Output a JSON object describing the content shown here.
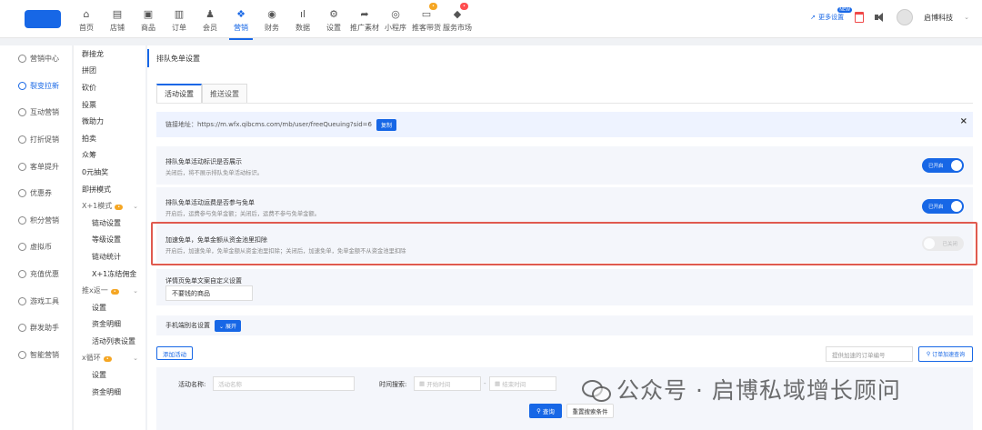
{
  "topnav": {
    "items": [
      {
        "label": "首页",
        "icon": "home-icon",
        "glyph": "⌂"
      },
      {
        "label": "店铺",
        "icon": "store-icon",
        "glyph": "▤"
      },
      {
        "label": "商品",
        "icon": "product-icon",
        "glyph": "▣"
      },
      {
        "label": "订单",
        "icon": "order-icon",
        "glyph": "▥"
      },
      {
        "label": "会员",
        "icon": "member-icon",
        "glyph": "♟"
      },
      {
        "label": "营销",
        "icon": "marketing-icon",
        "glyph": "❖",
        "active": true
      },
      {
        "label": "财务",
        "icon": "finance-icon",
        "glyph": "◉"
      },
      {
        "label": "数据",
        "icon": "data-icon",
        "glyph": "ıl"
      },
      {
        "label": "设置",
        "icon": "settings-icon",
        "glyph": "⚙"
      },
      {
        "label": "推广素材",
        "icon": "share-icon",
        "glyph": "➦"
      },
      {
        "label": "小程序",
        "icon": "miniprogram-icon",
        "glyph": "◎"
      },
      {
        "label": "推客带货",
        "icon": "promoter-icon",
        "glyph": "▭"
      },
      {
        "label": "服务市场",
        "icon": "market-icon",
        "glyph": "◆"
      }
    ],
    "more_settings": "更多设置",
    "user_name": "启博科技"
  },
  "sidebar1": [
    {
      "label": "营销中心"
    },
    {
      "label": "裂变拉新",
      "active": true
    },
    {
      "label": "互动营销"
    },
    {
      "label": "打折促销"
    },
    {
      "label": "客单提升"
    },
    {
      "label": "优惠券"
    },
    {
      "label": "积分营销"
    },
    {
      "label": "虚拟币"
    },
    {
      "label": "充值优惠"
    },
    {
      "label": "游戏工具"
    },
    {
      "label": "群发助手"
    },
    {
      "label": "智能营销"
    }
  ],
  "sidebar2": {
    "items": [
      "群接龙",
      "拼团",
      "砍价",
      "投票",
      "微助力",
      "拍卖",
      "众筹",
      "0元抽奖",
      "即拼模式"
    ],
    "group1": {
      "label": "X+1模式",
      "subs": [
        "链动设置",
        "等级设置",
        "链动统计",
        "X+1冻结佣金"
      ]
    },
    "group2": {
      "label": "推x返一",
      "subs": [
        "设置",
        "资金明细",
        "活动列表设置"
      ]
    },
    "group3": {
      "label": "x循环",
      "subs": [
        "设置",
        "资金明细"
      ]
    }
  },
  "page": {
    "title": "排队免单设置",
    "tabs": [
      "活动设置",
      "推送设置"
    ],
    "link_label": "链接地址：https://m.wfx.qibcms.com/mb/user/freeQueuing?sid=6",
    "copy_label": "复制",
    "close_glyph": "×",
    "settings": [
      {
        "title": "排队免单活动标识是否展示",
        "desc": "关闭后，将不展示排队免单活动标识。",
        "toggle": "已开启",
        "on": true
      },
      {
        "title": "排队免单活动运费是否参与免单",
        "desc": "开启后，运费参与免单金额；关闭后，运费不参与免单金额。",
        "toggle": "已开启",
        "on": true
      },
      {
        "title": "加速免单，免单金额从资金池里扣除",
        "desc": "开启后，加速免单，免单金额从资金池里扣除；关闭后，加速免单，免单金额不从资金池里扣除",
        "toggle": "已关闭",
        "on": false
      }
    ],
    "detail_title": "详情页免单文案自定义设置",
    "detail_value": "不要钱的商品",
    "nick_title": "手机端别名设置",
    "expand_label": "展开",
    "add_activity": "添加活动",
    "order_placeholder": "提供加速的订单编号",
    "order_search": "订单加速查询",
    "search": {
      "name_label": "活动名称:",
      "name_placeholder": "活动名称",
      "time_label": "时间搜索:",
      "start_placeholder": "开始时间",
      "end_placeholder": "结束时间",
      "dash": "-",
      "query": "查询",
      "reset": "重置搜索条件"
    }
  },
  "watermark": "公众号 · 启博私域增长顾问",
  "colors": {
    "accent": "#1767e6",
    "highlight": "#e05a4f"
  }
}
